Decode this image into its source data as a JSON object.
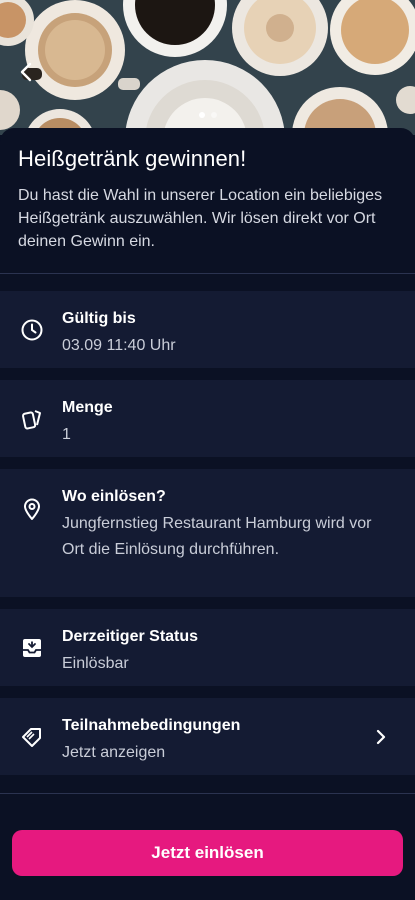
{
  "hero": {
    "image_alt": "coffee-cups-photo",
    "dots_count": 2,
    "active_dot": 0
  },
  "offer": {
    "title": "Heißgetränk gewinnen!",
    "description": "Du hast die Wahl in unserer Location ein beliebiges Heißgetränk auszuwählen. Wir lösen direkt vor Ort deinen Gewinn ein."
  },
  "details": [
    {
      "icon": "clock-icon",
      "label": "Gültig bis",
      "value": "03.09 11:40 Uhr"
    },
    {
      "icon": "cards-icon",
      "label": "Menge",
      "value": "1"
    },
    {
      "icon": "location-pin-icon",
      "label": "Wo einlösen?",
      "value": "Jungfernstieg Restaurant Hamburg wird vor Ort die Einlösung durchführen."
    },
    {
      "icon": "inbox-icon",
      "label": "Derzeitiger Status",
      "value": "Einlösbar"
    },
    {
      "icon": "ticket-icon",
      "label": "Teilnahmebedingungen",
      "value": "Jetzt anzeigen"
    }
  ],
  "cta": {
    "label": "Jetzt einlösen"
  },
  "colors": {
    "background": "#0b1124",
    "card": "#141b33",
    "accent": "#e6197f"
  }
}
